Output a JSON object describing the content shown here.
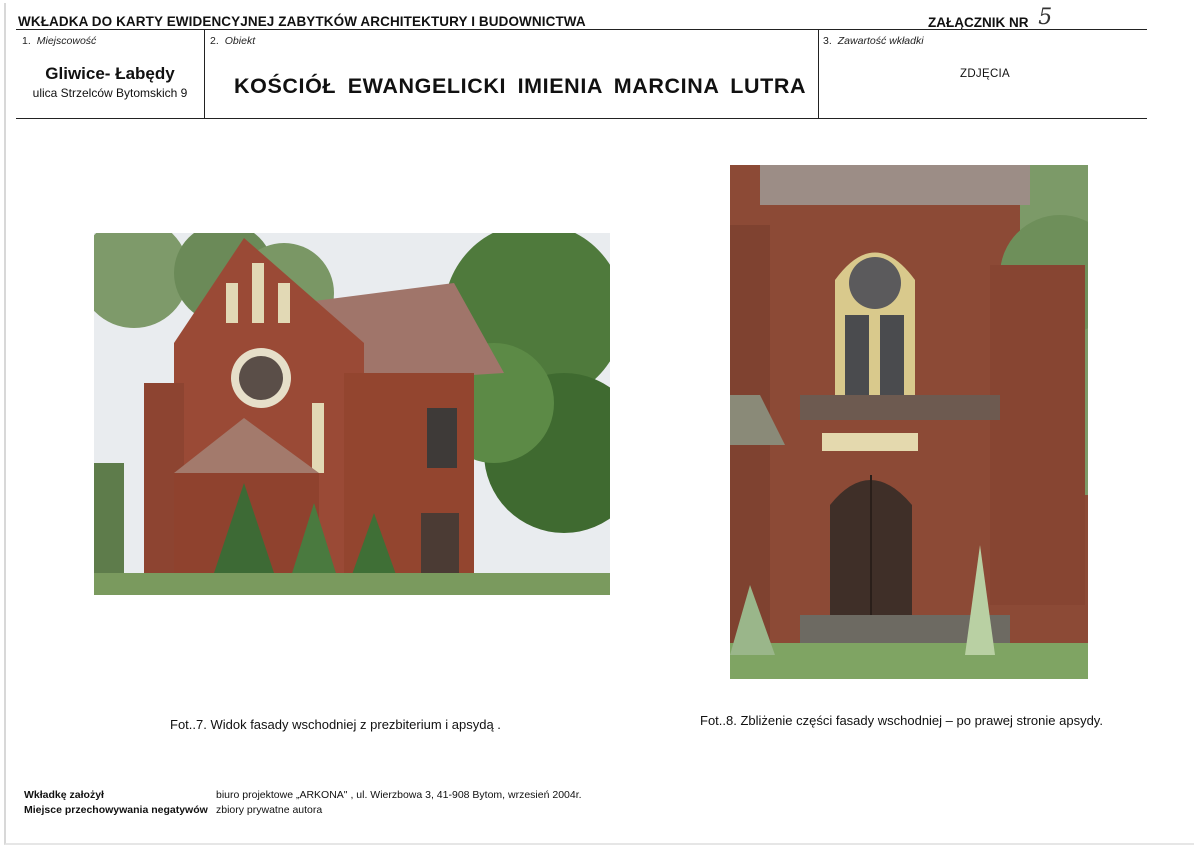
{
  "header": {
    "title": "WKŁADKA DO KARTY EWIDENCYJNEJ ZABYTKÓW ARCHITEKTURY I BUDOWNICTWA",
    "attachment_label": "ZAŁĄCZNIK NR",
    "attachment_number": "5"
  },
  "fields": {
    "locality_label_num": "1.",
    "locality_label": "Miejscowość",
    "locality": "Gliwice- Łabędy",
    "street": "ulica Strzelców Bytomskich 9",
    "object_label_num": "2.",
    "object_label": "Obiekt",
    "object_name": "KOŚCIÓŁ EWANGELICKI IMIENIA MARCINA LUTRA",
    "contents_label_num": "3.",
    "contents_label": "Zawartość wkładki",
    "contents": "ZDJĘCIA"
  },
  "photos": [
    {
      "caption": "Fot..7. Widok fasady wschodniej z prezbiterium i apsydą ."
    },
    {
      "caption": "Fot..8. Zbliżenie części fasady wschodniej – po prawej stronie apsydy."
    }
  ],
  "footer": {
    "created_label": "Wkładkę założył",
    "created_value": "biuro projektowe „ARKONA\" , ul. Wierzbowa 3, 41-908 Bytom, wrzesień 2004r.",
    "storage_label": "Miejsce przechowywania negatywów",
    "storage_value": "zbiory prywatne autora"
  }
}
